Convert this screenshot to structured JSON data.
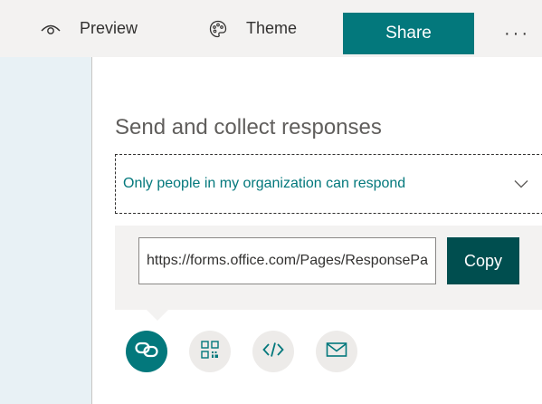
{
  "toolbar": {
    "preview_label": "Preview",
    "preview_icon": "eye-icon",
    "theme_label": "Theme",
    "theme_icon": "palette-icon",
    "share_label": "Share",
    "more_label": "···",
    "more_icon": "more-icon"
  },
  "share_panel": {
    "heading": "Send and collect responses",
    "audience_dropdown": {
      "selected": "Only people in my organization can respond",
      "icon": "chevron-down-icon"
    },
    "link": {
      "url": "https://forms.office.com/Pages/ResponsePage.aspx",
      "copy_label": "Copy"
    },
    "share_options": [
      {
        "icon": "link-icon",
        "active": true
      },
      {
        "icon": "qr-code-icon",
        "active": false
      },
      {
        "icon": "embed-icon",
        "active": false
      },
      {
        "icon": "email-icon",
        "active": false
      }
    ]
  },
  "colors": {
    "accent": "#03787c",
    "copy_button": "#004e4f",
    "toolbar_bg": "#f3f2f1",
    "left_strip": "#e8f1f5"
  }
}
